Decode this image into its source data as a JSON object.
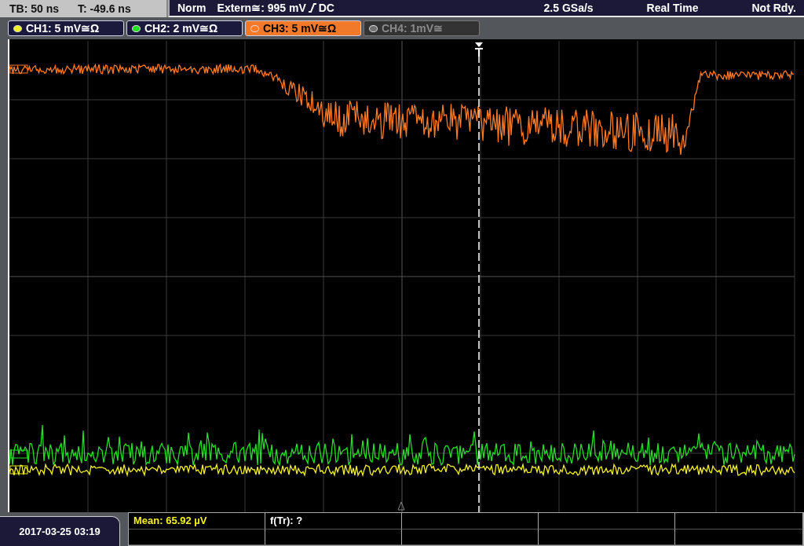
{
  "status_bar": {
    "timebase": "TB: 50 ns",
    "trigger_time": "T: -49.6 ns",
    "mode": "Norm",
    "trigger_source": "Extern≅: 995 mV",
    "coupling": "DC",
    "sample_rate": "2.5 GSa/s",
    "acquisition": "Real Time",
    "state": "Not Rdy."
  },
  "channels": [
    {
      "label": "CH1: 5 mV≅Ω",
      "color": "#f5f020",
      "selected": false,
      "disabled": false
    },
    {
      "label": "CH2: 2 mV≅Ω",
      "color": "#22e022",
      "selected": false,
      "disabled": false
    },
    {
      "label": "CH3: 5 mV≅Ω",
      "color": "#ff7a22",
      "selected": true,
      "disabled": false
    },
    {
      "label": "CH4: 1mV≅",
      "color": "#707070",
      "selected": false,
      "disabled": true
    }
  ],
  "date_time": "2017-03-25 03:19",
  "measurements": [
    {
      "text": "Mean: 65.92 µV",
      "color": "#f5f020"
    },
    {
      "text": "f(Tr): ?",
      "color": "#ffffff"
    }
  ]
}
